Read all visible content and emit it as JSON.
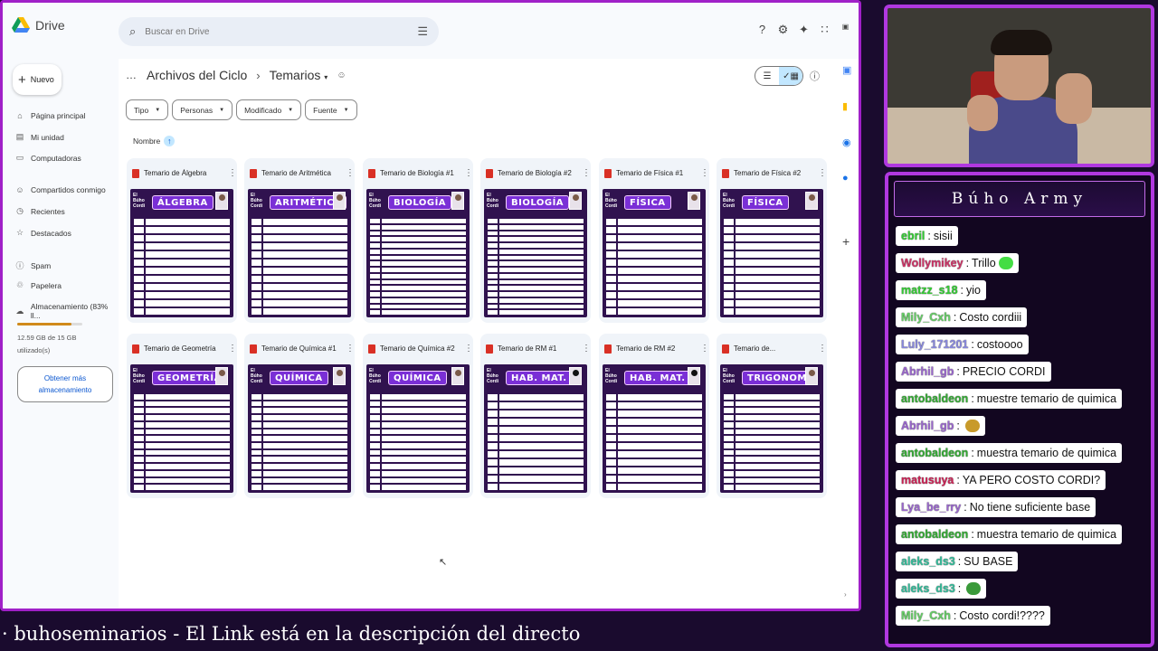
{
  "drive": {
    "logo_text": "Drive",
    "search_placeholder": "Buscar en Drive",
    "new_label": "Nuevo",
    "nav": [
      {
        "label": "Página principal",
        "icon": "home-icon"
      },
      {
        "label": "Mi unidad",
        "icon": "drive-icon"
      },
      {
        "label": "Computadoras",
        "icon": "computer-icon"
      },
      {
        "label": "Compartidos conmigo",
        "icon": "people-icon"
      },
      {
        "label": "Recientes",
        "icon": "clock-icon"
      },
      {
        "label": "Destacados",
        "icon": "star-icon"
      },
      {
        "label": "Spam",
        "icon": "spam-icon"
      },
      {
        "label": "Papelera",
        "icon": "trash-icon"
      },
      {
        "label": "Almacenamiento (83% ll...",
        "icon": "cloud-icon"
      }
    ],
    "storage_text": "12.59 GB de 15 GB utilizado(s)",
    "storage_fraction": 0.83,
    "storage_button": "Obtener más almacenamiento",
    "breadcrumb": {
      "parent": "Archivos del Ciclo",
      "current": "Temarios"
    },
    "filters": [
      "Tipo",
      "Personas",
      "Modificado",
      "Fuente"
    ],
    "sort_label": "Nombre",
    "files": [
      {
        "name": "Temario de Álgebra",
        "thumb": "ÁLGEBRA",
        "rows": 12
      },
      {
        "name": "Temario de Aritmética",
        "thumb": "ARITMÉTICA",
        "rows": 12
      },
      {
        "name": "Temario de Biología #1",
        "thumb": "BIOLOGÍA",
        "rows": 16
      },
      {
        "name": "Temario de Biología #2",
        "thumb": "BIOLOGÍA",
        "rows": 16
      },
      {
        "name": "Temario de Física #1",
        "thumb": "FÍSICA",
        "rows": 12
      },
      {
        "name": "Temario de Física #2",
        "thumb": "FÍSICA",
        "rows": 12
      },
      {
        "name": "Temario de Geometría",
        "thumb": "GEOMETRÍA",
        "rows": 14
      },
      {
        "name": "Temario de Química #1",
        "thumb": "QUÍMICA",
        "rows": 14
      },
      {
        "name": "Temario de Química #2",
        "thumb": "QUÍMICA",
        "rows": 14
      },
      {
        "name": "Temario de RM #1",
        "thumb": "HAB. MAT.",
        "rows": 12
      },
      {
        "name": "Temario de RM #2",
        "thumb": "HAB. MAT.",
        "rows": 12
      },
      {
        "name": "Temario de...",
        "thumb": "TRIGONOM.",
        "rows": 14
      }
    ],
    "thumb_brand": "El Búho Cordi"
  },
  "chat": {
    "title": "Búho Army",
    "messages": [
      {
        "user": "ebril",
        "color": "#33cc33",
        "text": "sisii"
      },
      {
        "user": "Wollymikey",
        "color": "#cc3366",
        "text": "Trillo",
        "emoji": "#44dd44"
      },
      {
        "user": "matzz_s18",
        "color": "#33cc33",
        "text": "yio"
      },
      {
        "user": "Mily_Cxh",
        "color": "#66cc66",
        "text": "Costo cordiii"
      },
      {
        "user": "Luly_171201",
        "color": "#8888dd",
        "text": "costoooo"
      },
      {
        "user": "Abrhil_gb",
        "color": "#9966cc",
        "text": "PRECIO CORDI"
      },
      {
        "user": "antobaldeon",
        "color": "#33aa33",
        "text": "muestre temario de quimica"
      },
      {
        "user": "Abrhil_gb",
        "color": "#9966cc",
        "text": "",
        "emoji": "#c89a2a"
      },
      {
        "user": "antobaldeon",
        "color": "#33aa33",
        "text": "muestra temario de quimica"
      },
      {
        "user": "matusuya",
        "color": "#cc2255",
        "text": "YA PERO COSTO CORDI?"
      },
      {
        "user": "Lya_be_rry",
        "color": "#9966cc",
        "text": "No tiene suficiente base"
      },
      {
        "user": "antobaldeon",
        "color": "#33aa33",
        "text": "muestra temario de quimica"
      },
      {
        "user": "aleks_ds3",
        "color": "#33bb99",
        "text": "SU BASE"
      },
      {
        "user": "aleks_ds3",
        "color": "#33bb99",
        "text": "",
        "emoji": "#3a9a3a"
      },
      {
        "user": "Mily_Cxh",
        "color": "#66cc66",
        "text": "Costo cordi!????"
      }
    ]
  },
  "ticker": "· buhoseminarios   -   El Link está en la descripción del directo"
}
